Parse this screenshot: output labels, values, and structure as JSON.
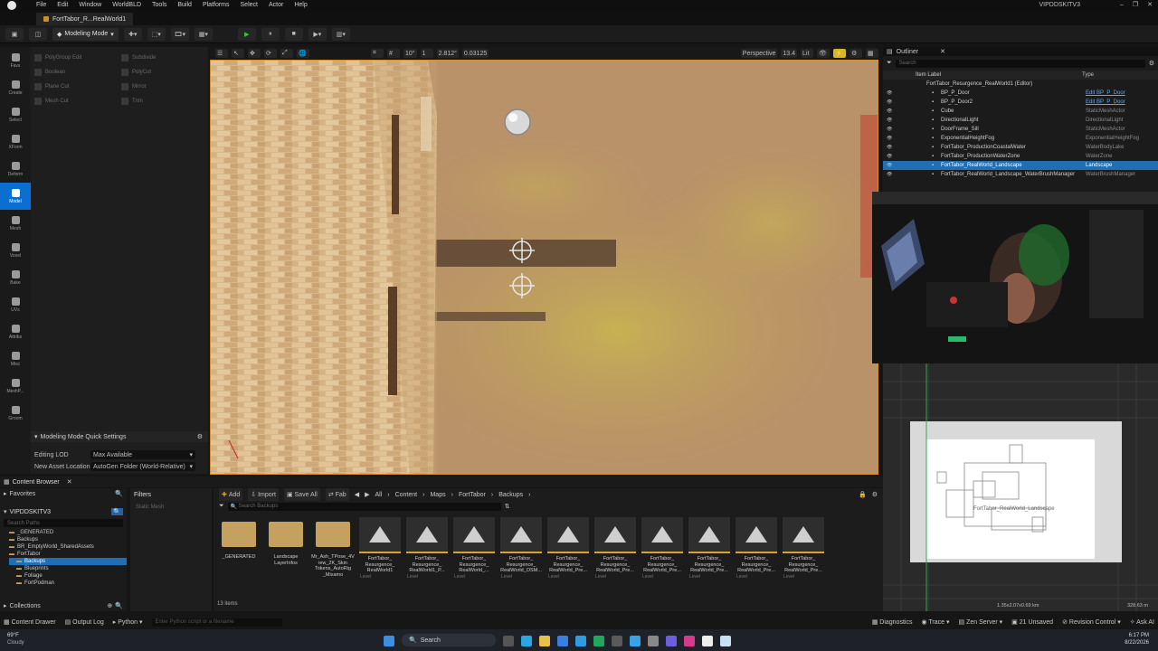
{
  "menubar": {
    "items": [
      "File",
      "Edit",
      "Window",
      "WorldBLD",
      "Tools",
      "Build",
      "Platforms",
      "Select",
      "Actor",
      "Help"
    ],
    "project": "VIPDDSKITV3"
  },
  "doc_tab": {
    "label": "FortTabor_R...RealWorld1"
  },
  "toolbar": {
    "mode_label": "Modeling Mode"
  },
  "toolstrip": {
    "items": [
      "Favs",
      "Create",
      "Select",
      "XForm",
      "Deform",
      "Model",
      "Mesh",
      "Voxel",
      "Bake",
      "UVs",
      "Attribs",
      "Misc",
      "MeshP...",
      "Groom"
    ]
  },
  "modeling": {
    "buttons": [
      "PolyGroup Edit",
      "Subdivide",
      "Boolean",
      "PolyCut",
      "Plane Cut",
      "Mirror",
      "Mesh Cut",
      "Trim"
    ],
    "quick_settings_title": "Modeling Mode Quick Settings",
    "editing_lod_label": "Editing LOD",
    "editing_lod_value": "Max Available",
    "new_asset_label": "New Asset Location",
    "new_asset_value": "AutoGen Folder (World-Relative)"
  },
  "viewport": {
    "perspective": "Perspective",
    "lit": "Lit",
    "fov": "13.4",
    "snap_rot": "10°",
    "snap_scale": "0.03125",
    "snap_size": "2.812°",
    "cam_speed": "1"
  },
  "outliner": {
    "title": "Outliner",
    "search_placeholder": "Search",
    "col_label": "Item Label",
    "col_type": "Type",
    "root": "FortTabor_Resurgence_RealWorld1 (Editor)",
    "rows": [
      {
        "name": "BP_P_Door",
        "type": "Edit BP_P_Door",
        "link": true
      },
      {
        "name": "BP_P_Door2",
        "type": "Edit BP_P_Door",
        "link": true
      },
      {
        "name": "Cube",
        "type": "StaticMeshActor",
        "link": false
      },
      {
        "name": "DirectionalLight",
        "type": "DirectionalLight",
        "link": false
      },
      {
        "name": "DoorFrame_Sill",
        "type": "StaticMeshActor",
        "link": false
      },
      {
        "name": "ExponentialHeightFog",
        "type": "ExponentialHeightFog",
        "link": false
      },
      {
        "name": "FortTabor_ProductionCoastalWater",
        "type": "WaterBodyLake",
        "link": false
      },
      {
        "name": "FortTabor_ProductionWaterZone",
        "type": "WaterZone",
        "link": false
      },
      {
        "name": "FortTabor_RealWorld_Landscape",
        "type": "Landscape",
        "link": false,
        "selected": true
      },
      {
        "name": "FortTabor_RealWorld_Landscape_WaterBrushManager",
        "type": "WaterBrushManager",
        "link": false
      }
    ]
  },
  "minimap": {
    "label": "FortTabor_RealWorld_Landscape",
    "scale": "1.35x2.07x0.69 km",
    "dist": "328.63 m"
  },
  "content_browser": {
    "tab_title": "Content Browser",
    "favorites": "Favorites",
    "filters": "Filters",
    "filter_item": "Static Mesh",
    "project": "VIPDDSKITV3",
    "search_paths_placeholder": "Search Paths",
    "tree": [
      "_GENERATED",
      "Backups",
      "BR_EmptyWorld_SharedAssets",
      "FortTabor",
      "Backups",
      "Blueprints",
      "Foliage",
      "FortPodman"
    ],
    "collections": "Collections",
    "add": "Add",
    "import": "Import",
    "save_all": "Save All",
    "fab": "Fab",
    "breadcrumb": [
      "All",
      "Content",
      "Maps",
      "FortTabor",
      "Backups"
    ],
    "search_placeholder": "Search Backups",
    "items_count": "13 items",
    "assets": [
      {
        "name": "_GENERATED",
        "kind": "folder",
        "sub": ""
      },
      {
        "name": "Landscape LayerInfos",
        "kind": "folder",
        "sub": ""
      },
      {
        "name": "Mr_Ash_TPose_4View_2K_Skin Tokens_AutoRig _Mixamo",
        "kind": "folder",
        "sub": ""
      },
      {
        "name": "FortTabor_ Resurgence_ RealWorld1",
        "kind": "level",
        "sub": "Level"
      },
      {
        "name": "FortTabor_ Resurgence_ RealWorld1_P...",
        "kind": "level",
        "sub": "Level"
      },
      {
        "name": "FortTabor_ Resurgence_ RealWorld_...",
        "kind": "level",
        "sub": "Level"
      },
      {
        "name": "FortTabor_ Resurgence_ RealWorld_OSM...",
        "kind": "level",
        "sub": "Level"
      },
      {
        "name": "FortTabor_ Resurgence_ RealWorld_Pre...",
        "kind": "level",
        "sub": "Level"
      },
      {
        "name": "FortTabor_ Resurgence_ RealWorld_Pre...",
        "kind": "level",
        "sub": "Level"
      },
      {
        "name": "FortTabor_ Resurgence_ RealWorld_Pre...",
        "kind": "level",
        "sub": "Level"
      },
      {
        "name": "FortTabor_ Resurgence_ RealWorld_Pre...",
        "kind": "level",
        "sub": "Level"
      },
      {
        "name": "FortTabor_ Resurgence_ RealWorld_Pre...",
        "kind": "level",
        "sub": "Level"
      },
      {
        "name": "FortTabor_ Resurgence_ RealWorld_Pre...",
        "kind": "level",
        "sub": "Level"
      }
    ]
  },
  "statusbar": {
    "content_drawer": "Content Drawer",
    "output_log": "Output Log",
    "python": "Python",
    "cmd_placeholder": "Enter Python script or a filename",
    "diagnostics": "Diagnostics",
    "trace": "Trace",
    "zen": "Zen Server",
    "unsaved": "21 Unsaved",
    "revision": "Revision Control",
    "ask": "Ask AI"
  },
  "taskbar": {
    "weather_temp": "69°F",
    "weather_desc": "Cloudy",
    "search": "Search",
    "time": "6:17 PM",
    "date": "8/22/2026"
  },
  "colors": {
    "accent": "#d58c2b",
    "selection": "#1f6fb7",
    "active_tool": "#0b6fd1"
  }
}
